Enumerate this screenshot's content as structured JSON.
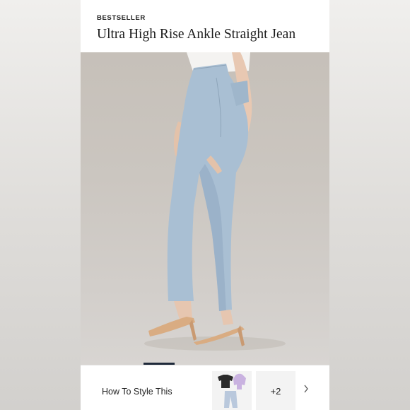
{
  "product": {
    "badge": "BESTSELLER",
    "title": "Ultra High Rise Ankle Straight Jean"
  },
  "style": {
    "label": "How To Style This",
    "more_count": "+2"
  },
  "icons": {
    "next": "chevron-right-icon"
  },
  "colors": {
    "denim": "#a9bfd3",
    "background": "#cbc6c0",
    "sandal": "#d9ac82"
  }
}
